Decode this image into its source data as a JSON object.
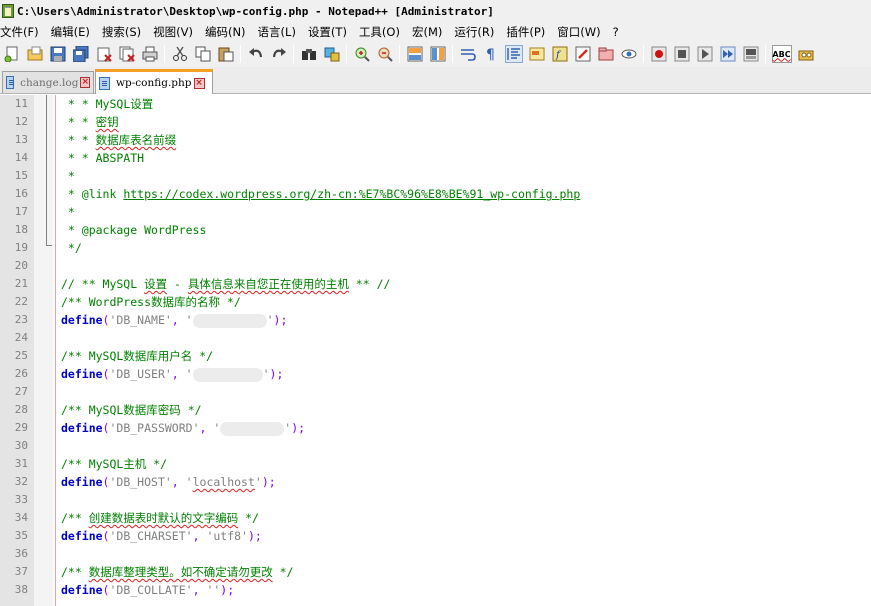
{
  "window": {
    "title": "C:\\Users\\Administrator\\Desktop\\wp-config.php - Notepad++ [Administrator]"
  },
  "menu": [
    "文件(F)",
    "编辑(E)",
    "搜索(S)",
    "视图(V)",
    "编码(N)",
    "语言(L)",
    "设置(T)",
    "工具(O)",
    "宏(M)",
    "运行(R)",
    "插件(P)",
    "窗口(W)",
    "?"
  ],
  "toolbar": {
    "icons": [
      "new-file-icon",
      "open-file-icon",
      "save-icon",
      "save-all-icon",
      "close-icon",
      "close-all-icon",
      "print-icon",
      "cut-icon",
      "copy-icon",
      "paste-icon",
      "undo-icon",
      "redo-icon",
      "find-icon",
      "replace-icon",
      "zoom-in-icon",
      "zoom-out-icon",
      "sync-v-icon",
      "sync-h-icon",
      "wrap-icon",
      "show-all-chars-icon",
      "indent-guide-icon",
      "doc-map-icon",
      "function-list-icon",
      "folder-workspace-icon",
      "monitor-icon",
      "record-icon",
      "stop-icon",
      "play-icon",
      "play-multiple-icon",
      "save-macro-icon",
      "spellcheck-icon",
      "plugin-icon"
    ],
    "spellcheck_label": "ABC"
  },
  "tabs": [
    {
      "label": "change.log",
      "active": false
    },
    {
      "label": "wp-config.php",
      "active": true
    }
  ],
  "editor": {
    "lines": [
      {
        "num": "11",
        "parts": [
          {
            "t": " * * ",
            "c": "cm"
          },
          {
            "t": "MySQL设置",
            "c": "cm"
          }
        ]
      },
      {
        "num": "12",
        "parts": [
          {
            "t": " * * ",
            "c": "cm"
          },
          {
            "t": "密钥",
            "c": "cm wavy"
          }
        ]
      },
      {
        "num": "13",
        "parts": [
          {
            "t": " * * ",
            "c": "cm"
          },
          {
            "t": "数据库表名前缀",
            "c": "cm wavy"
          }
        ]
      },
      {
        "num": "14",
        "parts": [
          {
            "t": " * * ABSPATH",
            "c": "cm"
          }
        ]
      },
      {
        "num": "15",
        "parts": [
          {
            "t": " *",
            "c": "cm"
          }
        ]
      },
      {
        "num": "16",
        "parts": [
          {
            "t": " * @link ",
            "c": "cm"
          },
          {
            "t": "https://codex.wordpress.org/zh-cn:%E7%BC%96%E8%BE%91_wp-config.php",
            "c": "url"
          }
        ]
      },
      {
        "num": "17",
        "parts": [
          {
            "t": " *",
            "c": "cm"
          }
        ]
      },
      {
        "num": "18",
        "parts": [
          {
            "t": " * @package WordPress",
            "c": "cm"
          }
        ]
      },
      {
        "num": "19",
        "parts": [
          {
            "t": " */",
            "c": "cm"
          }
        ]
      },
      {
        "num": "20",
        "parts": []
      },
      {
        "num": "21",
        "parts": [
          {
            "t": "// ** MySQL ",
            "c": "cm"
          },
          {
            "t": "设置",
            "c": "cm wavy"
          },
          {
            "t": " - ",
            "c": "cm"
          },
          {
            "t": "具体信息来自您正在使用的主机",
            "c": "cm wavy"
          },
          {
            "t": " ** //",
            "c": "cm"
          }
        ]
      },
      {
        "num": "22",
        "parts": [
          {
            "t": "/** WordPress数据库的名称 */",
            "c": "cm"
          }
        ]
      },
      {
        "num": "23",
        "parts": [
          {
            "t": "define",
            "c": "kw"
          },
          {
            "t": "(",
            "c": "op"
          },
          {
            "t": "'DB_NAME'",
            "c": "str"
          },
          {
            "t": ", ",
            "c": "op"
          },
          {
            "t": "'",
            "c": "str"
          },
          {
            "redact": 74
          },
          {
            "t": "'",
            "c": "str"
          },
          {
            "t": ");",
            "c": "op"
          }
        ]
      },
      {
        "num": "24",
        "parts": []
      },
      {
        "num": "25",
        "parts": [
          {
            "t": "/** MySQL数据库用户名 */",
            "c": "cm"
          }
        ]
      },
      {
        "num": "26",
        "parts": [
          {
            "t": "define",
            "c": "kw"
          },
          {
            "t": "(",
            "c": "op"
          },
          {
            "t": "'DB_USER'",
            "c": "str"
          },
          {
            "t": ", ",
            "c": "op"
          },
          {
            "t": "'",
            "c": "str"
          },
          {
            "redact": 70
          },
          {
            "t": "'",
            "c": "str"
          },
          {
            "t": ");",
            "c": "op"
          }
        ]
      },
      {
        "num": "27",
        "parts": []
      },
      {
        "num": "28",
        "parts": [
          {
            "t": "/** MySQL数据库密码 */",
            "c": "cm"
          }
        ]
      },
      {
        "num": "29",
        "parts": [
          {
            "t": "define",
            "c": "kw"
          },
          {
            "t": "(",
            "c": "op"
          },
          {
            "t": "'DB_PASSWORD'",
            "c": "str"
          },
          {
            "t": ", ",
            "c": "op"
          },
          {
            "t": "'",
            "c": "str"
          },
          {
            "redact": 64
          },
          {
            "t": "'",
            "c": "str"
          },
          {
            "t": ");",
            "c": "op"
          }
        ]
      },
      {
        "num": "30",
        "parts": []
      },
      {
        "num": "31",
        "parts": [
          {
            "t": "/** MySQL主机 */",
            "c": "cm"
          }
        ]
      },
      {
        "num": "32",
        "parts": [
          {
            "t": "define",
            "c": "kw"
          },
          {
            "t": "(",
            "c": "op"
          },
          {
            "t": "'DB_HOST'",
            "c": "str"
          },
          {
            "t": ", ",
            "c": "op"
          },
          {
            "t": "'",
            "c": "str"
          },
          {
            "t": "localhost",
            "c": "str wavy"
          },
          {
            "t": "'",
            "c": "str"
          },
          {
            "t": ");",
            "c": "op"
          }
        ]
      },
      {
        "num": "33",
        "parts": []
      },
      {
        "num": "34",
        "parts": [
          {
            "t": "/** ",
            "c": "cm"
          },
          {
            "t": "创建数据表时默认的文字编码",
            "c": "cm wavy"
          },
          {
            "t": " */",
            "c": "cm"
          }
        ]
      },
      {
        "num": "35",
        "parts": [
          {
            "t": "define",
            "c": "kw"
          },
          {
            "t": "(",
            "c": "op"
          },
          {
            "t": "'DB_CHARSET'",
            "c": "str"
          },
          {
            "t": ", ",
            "c": "op"
          },
          {
            "t": "'utf8'",
            "c": "str"
          },
          {
            "t": ");",
            "c": "op"
          }
        ]
      },
      {
        "num": "36",
        "parts": []
      },
      {
        "num": "37",
        "parts": [
          {
            "t": "/** ",
            "c": "cm"
          },
          {
            "t": "数据库整理类型。如不确定请勿更改",
            "c": "cm wavy"
          },
          {
            "t": " */",
            "c": "cm"
          }
        ]
      },
      {
        "num": "38",
        "parts": [
          {
            "t": "define",
            "c": "kw"
          },
          {
            "t": "(",
            "c": "op"
          },
          {
            "t": "'DB_COLLATE'",
            "c": "str"
          },
          {
            "t": ", ",
            "c": "op"
          },
          {
            "t": "''",
            "c": "str"
          },
          {
            "t": ");",
            "c": "op"
          }
        ]
      }
    ]
  }
}
